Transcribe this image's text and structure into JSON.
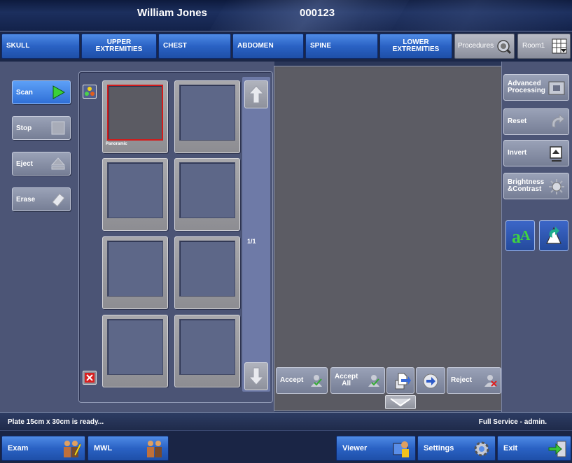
{
  "header": {
    "patient_name": "William Jones",
    "patient_id": "000123"
  },
  "tabs": {
    "skull": "SKULL",
    "upper_extremities": [
      "UPPER",
      "EXTREMITIES"
    ],
    "chest": "CHEST",
    "abdomen": "ABDOMEN",
    "spine": "SPINE",
    "lower_extremities": [
      "LOWER",
      "EXTREMITIES"
    ],
    "procedures": "Procedures",
    "room": "Room1"
  },
  "left_controls": {
    "scan": "Scan",
    "stop": "Stop",
    "eject": "Eject",
    "erase": "Erase"
  },
  "thumbnails": {
    "first_label": "Panoramic",
    "page_indicator": "1/1"
  },
  "viewer_actions": {
    "accept": "Accept",
    "accept_all": [
      "Accept",
      "All"
    ],
    "reject": "Reject"
  },
  "right_controls": {
    "advanced_processing": [
      "Advanced",
      "Processing"
    ],
    "reset": "Reset",
    "invert": "Invert",
    "brightness_contrast": [
      "Brightness",
      "&Contrast"
    ]
  },
  "status": {
    "message": "Plate 15cm x 30cm is ready...",
    "user": "Full Service - admin."
  },
  "bottom_bar": {
    "exam": "Exam",
    "mwl": "MWL",
    "viewer": "Viewer",
    "settings": "Settings",
    "exit": "Exit"
  },
  "colors": {
    "accent_blue": "#2a62c4",
    "selected_thumb_border": "#d21b1b",
    "scan_arrow": "#3ad13a"
  }
}
